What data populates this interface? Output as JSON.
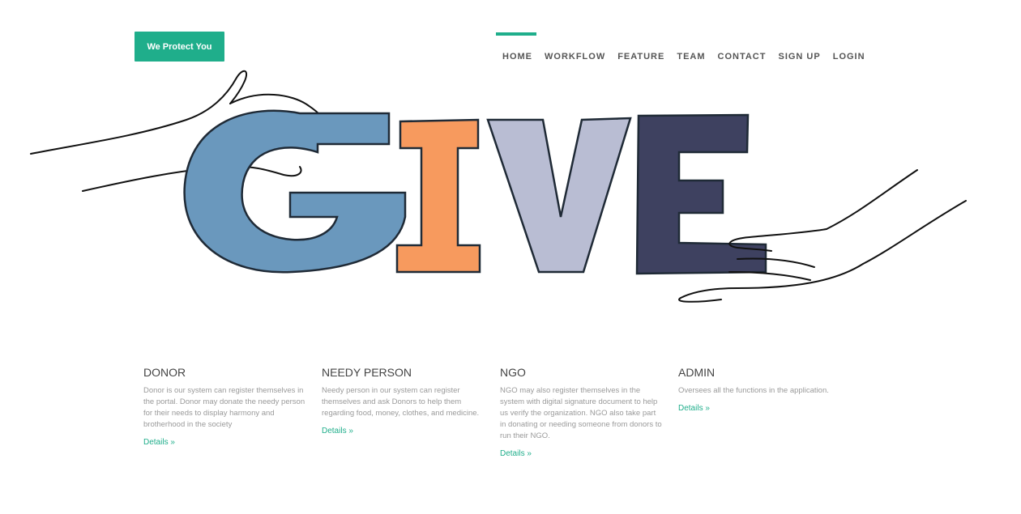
{
  "brand": {
    "label": "We Protect You"
  },
  "nav": {
    "items": [
      {
        "label": "HOME",
        "active": true
      },
      {
        "label": "WORKFLOW"
      },
      {
        "label": "FEATURE"
      },
      {
        "label": "TEAM"
      },
      {
        "label": "CONTACT"
      },
      {
        "label": "SIGN UP"
      },
      {
        "label": "LOGIN"
      }
    ]
  },
  "hero": {
    "letters": [
      "G",
      "I",
      "V",
      "E"
    ],
    "colors": {
      "g": "#6a98bd",
      "i": "#f79a5e",
      "v": "#b9bdd3",
      "e": "#3e4160"
    }
  },
  "features": [
    {
      "title": "DONOR",
      "description": "Donor is our system can register themselves in the portal. Donor may donate the needy person for their needs to display harmony and brotherhood in the society",
      "link": "Details »"
    },
    {
      "title": "NEEDY PERSON",
      "description": "Needy person in our system can register themselves and ask Donors to help them regarding food, money, clothes, and medicine.",
      "link": "Details »"
    },
    {
      "title": "NGO",
      "description": "NGO may also register themselves in the system with digital signature document to help us verify the organization. NGO also take part in donating or needing someone from donors to run their NGO.",
      "link": "Details »"
    },
    {
      "title": "ADMIN",
      "description": "Oversees all the functions in the application.",
      "link": "Details »"
    }
  ],
  "theme": {
    "accent": "#1fae8b"
  }
}
